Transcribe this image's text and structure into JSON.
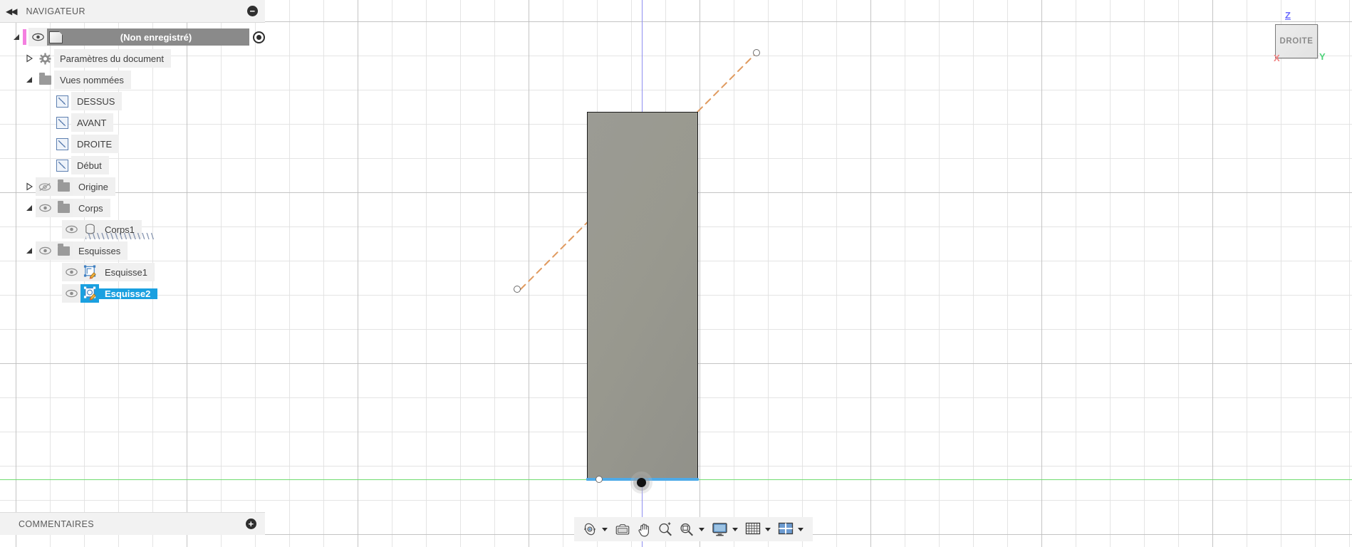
{
  "app": {
    "language": "fr",
    "accent_blue": "#1aa0e0",
    "axis_green": "#6fdc6f",
    "axis_blue": "#8e8ef0",
    "sketch_orange": "#e09a5f",
    "body_gray": "#98988f",
    "panel_bg": "#f2f2f2"
  },
  "navigator": {
    "title": "NAVIGATEUR",
    "collapse_icon": "double-chevron-left-icon",
    "minimize_icon": "minus-circle-icon",
    "root": {
      "label": "(Non enregistré)",
      "visibility_icon": "eye-icon",
      "document_icon": "cube-icon",
      "activate_icon": "radio-target-icon",
      "expanded": true,
      "selected": true
    },
    "items": [
      {
        "label": "Paramètres du document",
        "icon": "gear-icon",
        "twisty": "collapsed",
        "indent": 1,
        "has_eye": false,
        "selected": false
      },
      {
        "label": "Vues nommées",
        "icon": "folder-icon",
        "twisty": "expanded",
        "indent": 1,
        "has_eye": false,
        "selected": false
      },
      {
        "label": "DESSUS",
        "icon": "named-view-icon",
        "twisty": "none",
        "indent": 2,
        "has_eye": false,
        "selected": false
      },
      {
        "label": "AVANT",
        "icon": "named-view-icon",
        "twisty": "none",
        "indent": 2,
        "has_eye": false,
        "selected": false
      },
      {
        "label": "DROITE",
        "icon": "named-view-icon",
        "twisty": "none",
        "indent": 2,
        "has_eye": false,
        "selected": false
      },
      {
        "label": "Début",
        "icon": "named-view-icon",
        "twisty": "none",
        "indent": 2,
        "has_eye": false,
        "selected": false
      },
      {
        "label": "Origine",
        "icon": "folder-icon",
        "twisty": "collapsed",
        "indent": 1,
        "has_eye": true,
        "eye_state": "hidden",
        "selected": false
      },
      {
        "label": "Corps",
        "icon": "folder-icon",
        "twisty": "expanded",
        "indent": 1,
        "has_eye": true,
        "eye_state": "visible",
        "selected": false
      },
      {
        "label": "Corps1",
        "icon": "solid-body-icon",
        "twisty": "none",
        "indent": 2,
        "has_eye": true,
        "eye_state": "visible",
        "selected": false,
        "hatched": true
      },
      {
        "label": "Esquisses",
        "icon": "folder-icon",
        "twisty": "expanded",
        "indent": 1,
        "has_eye": true,
        "eye_state": "visible",
        "selected": false
      },
      {
        "label": "Esquisse1",
        "icon": "sketch-icon",
        "twisty": "none",
        "indent": 2,
        "has_eye": true,
        "eye_state": "visible",
        "selected": false
      },
      {
        "label": "Esquisse2",
        "icon": "sketch-icon",
        "twisty": "none",
        "indent": 2,
        "has_eye": true,
        "eye_state": "visible",
        "selected": true
      }
    ]
  },
  "comments": {
    "title": "COMMENTAIRES",
    "add_icon": "plus-circle-icon"
  },
  "viewcube": {
    "face_label": "DROITE",
    "axis_z": "Z",
    "axis_x": "X",
    "axis_y": "Y"
  },
  "bottom_toolbar": {
    "buttons": [
      {
        "name": "orbit-icon",
        "has_caret": true
      },
      {
        "name": "look-at-icon",
        "has_caret": false
      },
      {
        "name": "pan-hand-icon",
        "has_caret": false
      },
      {
        "name": "zoom-magnifier-icon",
        "has_caret": false
      },
      {
        "name": "fit-zoom-window-icon",
        "has_caret": true
      },
      {
        "name": "display-settings-icon",
        "has_caret": true
      },
      {
        "name": "grid-snap-icon",
        "has_caret": true
      },
      {
        "name": "viewport-layout-icon",
        "has_caret": true
      }
    ]
  },
  "canvas": {
    "body_label": "extruded-rectangle-body",
    "selected_edge": "bottom-edge",
    "origin_point": "sketch-origin-point",
    "construction_line": "sketch-line-orange-dashed",
    "endpoint_count": 3
  }
}
